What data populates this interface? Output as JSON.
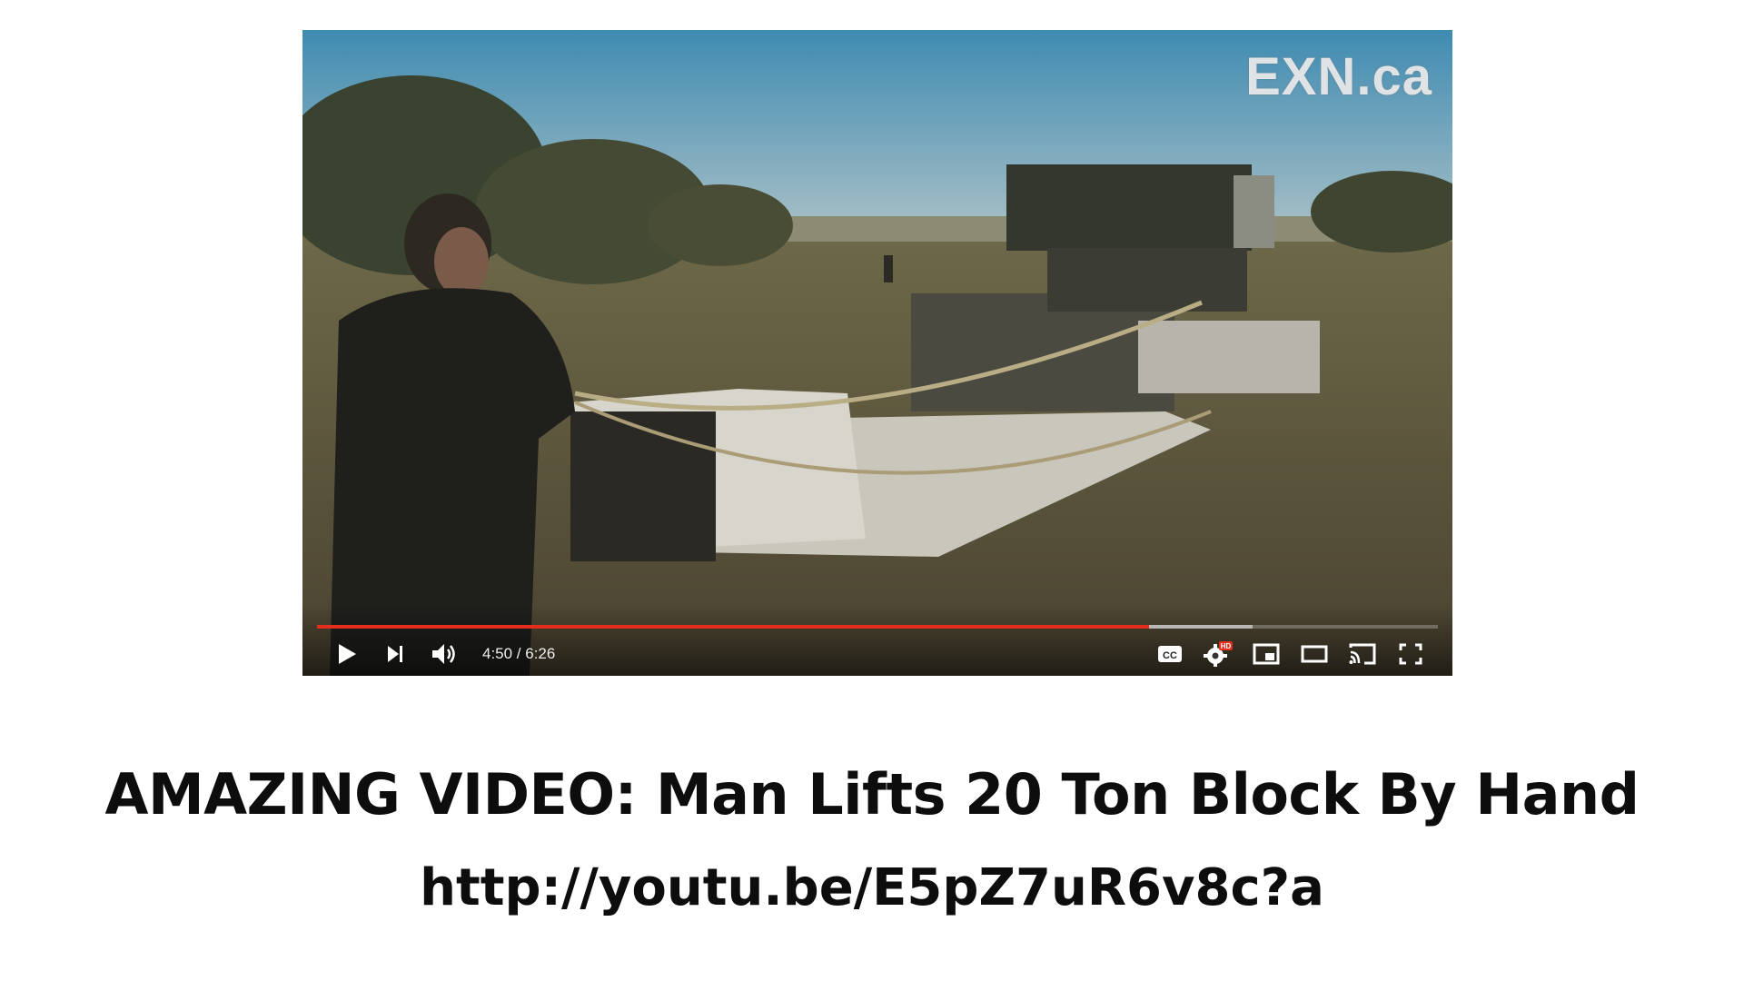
{
  "player": {
    "watermark": "EXN.ca",
    "time_display": "4:50 / 6:26",
    "progress_played_fraction": 0.7427,
    "progress_buffered_fraction": 0.835,
    "accent_color": "#e52d1d",
    "controls": {
      "left": [
        "play-icon",
        "next-icon",
        "volume-icon"
      ],
      "right": [
        "captions-icon",
        "settings-hd-icon",
        "miniplayer-icon",
        "theater-mode-icon",
        "cast-icon",
        "fullscreen-icon"
      ]
    },
    "captions_label": "CC",
    "hd_badge": "HD"
  },
  "caption": {
    "title": "AMAZING VIDEO: Man Lifts 20 Ton Block By Hand",
    "url": "http://youtu.be/E5pZ7uR6v8c?a"
  }
}
